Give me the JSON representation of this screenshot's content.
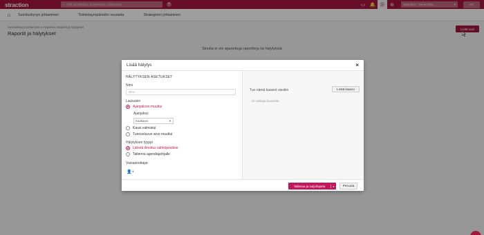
{
  "app": {
    "logo": "straction",
    "search_placeholder": "Etsi tavoitteista, projekteista, mittareista",
    "org_selector": "Straction - Generoiku...",
    "user_initials": "AV"
  },
  "nav": {
    "items": [
      "Suorituskyvyn johtaminen",
      "Toimintaympäristön seuranta",
      "Strateginen johtaminen"
    ]
  },
  "breadcrumb": "Suorituskyvyn johtaminen  ▸  Raportit  ▸  Raportit ja hälytykset",
  "page_title": "Raportit ja hälytykset",
  "add_new_label": "Lisää uusi",
  "empty_message": "Sinulla ei ole ajastettuja raportteja tai hälytyksiä",
  "modal": {
    "title": "Lisää hälytys",
    "close": "×",
    "section_heading": "HÄLYTYKSEN ASETUKSET",
    "name_label": "Nimi",
    "name_placeholder": "Nimi",
    "trigger_label": "Laukaisin",
    "trigger_options": [
      {
        "label": "Ajanjakson muuttui",
        "selected": true
      },
      {
        "label": "Kausi valmistui",
        "selected": false
      },
      {
        "label": "Tunnusluvun arvo muuttui",
        "selected": false
      }
    ],
    "period_label": "Ajanjakso",
    "period_value": "Kuukausi",
    "alert_type_label": "Hälytyksen tyyppi",
    "alert_type_options": [
      {
        "label": "Lähetä ilmoitus sähköpostitse",
        "selected": true
      },
      {
        "label": "Tallenna agendapohjalle",
        "selected": false
      }
    ],
    "recipients_label": "Vastaanottajat",
    "right_hint": "Tuo nämä kaaviot viestiin",
    "add_chart": "Lisää kaavio",
    "no_charts": "Ei valittuja kaavioita",
    "save_label": "Tallenna ja sulje/lopeta",
    "cancel_label": "Peruuta"
  },
  "colors": {
    "brand": "#a8163f",
    "accent": "#c2185b"
  }
}
